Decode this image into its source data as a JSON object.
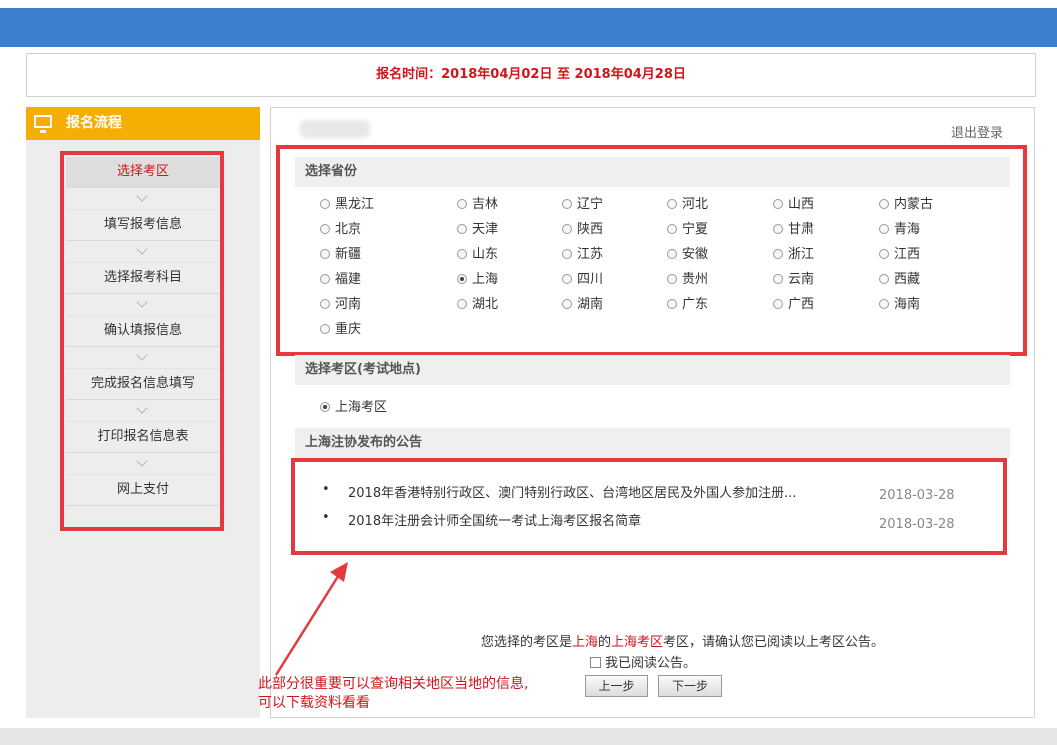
{
  "header": {
    "reg_time_label": "报名时间：",
    "reg_time_value": "2018年04月02日 至 2018年04月28日"
  },
  "sidebar": {
    "title": "报名流程",
    "steps": [
      {
        "label": "选择考区",
        "active": true
      },
      {
        "label": "填写报考信息"
      },
      {
        "label": "选择报考科目"
      },
      {
        "label": "确认填报信息"
      },
      {
        "label": "完成报名信息填写"
      },
      {
        "label": "打印报名信息表"
      },
      {
        "label": "网上支付"
      }
    ]
  },
  "main": {
    "logout": "退出登录",
    "province_section_title": "选择省份",
    "provinces": [
      [
        "黑龙江",
        "吉林",
        "辽宁",
        "河北",
        "山西",
        "内蒙古"
      ],
      [
        "北京",
        "天津",
        "陕西",
        "宁夏",
        "甘肃",
        "青海"
      ],
      [
        "新疆",
        "山东",
        "江苏",
        "安徽",
        "浙江",
        "江西"
      ],
      [
        "福建",
        "上海",
        "四川",
        "贵州",
        "云南",
        "西藏"
      ],
      [
        "河南",
        "湖北",
        "湖南",
        "广东",
        "广西",
        "海南"
      ],
      [
        "重庆"
      ]
    ],
    "selected_province": "上海",
    "exam_zone_section_title": "选择考区(考试地点)",
    "exam_zone": "上海考区",
    "notice_section_title": "上海注协发布的公告",
    "notices": [
      {
        "bullet": "•",
        "title": "2018年香港特别行政区、澳门特别行政区、台湾地区居民及外国人参加注册...",
        "date": "2018-03-28"
      },
      {
        "bullet": "•",
        "title": "2018年注册会计师全国统一考试上海考区报名简章",
        "date": "2018-03-28"
      }
    ],
    "confirm": {
      "prefix": "您选择的考区是",
      "province": "上海",
      "mid": "的",
      "zone": "上海考区",
      "suffix": "考区，请确认您已阅读以上考区公告。"
    },
    "read_checkbox_label": "我已阅读公告。",
    "prev_button": "上一步",
    "next_button": "下一步"
  },
  "annotation": {
    "line1": "此部分很重要可以查询相关地区当地的信息,",
    "line2": "可以下载资料看看"
  },
  "colors": {
    "top_bar": "#3d7fd1",
    "sidebar_header": "#f4ae04",
    "highlight_red": "#d0161b",
    "annotation_box": "#e43a3f"
  }
}
